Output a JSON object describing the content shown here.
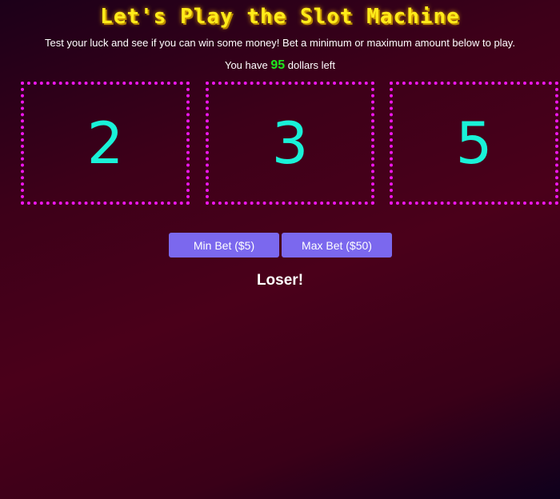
{
  "header": {
    "title": "Let's Play the Slot Machine",
    "subtitle": "Test your luck and see if you can win some money! Bet a minimum or maximum amount below to play."
  },
  "balance": {
    "prefix": "You have",
    "amount": "95",
    "suffix": "dollars left"
  },
  "reels": [
    "2",
    "3",
    "5"
  ],
  "buttons": {
    "min_bet_label": "Min Bet ($5)",
    "max_bet_label": "Max Bet ($50)"
  },
  "result": "Loser!",
  "colors": {
    "title": "#ffec1a",
    "reel_border": "#ee16ee",
    "reel_number": "#19f2d8",
    "amount": "#1ee81e",
    "button": "#7b68ee"
  }
}
